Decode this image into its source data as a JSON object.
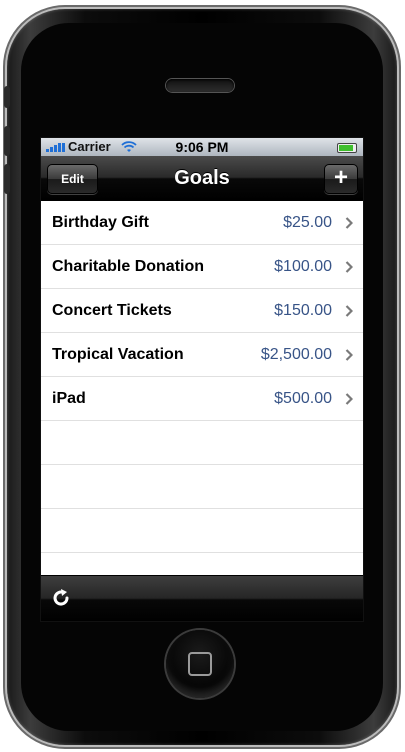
{
  "status_bar": {
    "carrier": "Carrier",
    "time": "9:06 PM"
  },
  "nav_bar": {
    "title": "Goals",
    "edit_label": "Edit",
    "add_label": "+"
  },
  "goals": [
    {
      "name": "Birthday Gift",
      "amount": "$25.00"
    },
    {
      "name": "Charitable Donation",
      "amount": "$100.00"
    },
    {
      "name": "Concert Tickets",
      "amount": "$150.00"
    },
    {
      "name": "Tropical Vacation",
      "amount": "$2,500.00"
    },
    {
      "name": "iPad",
      "amount": "$500.00"
    }
  ],
  "toolbar": {
    "refresh_icon": "refresh-icon"
  },
  "colors": {
    "value_text": "#385487",
    "nav_bar": "#1a1a1a",
    "battery": "#3fbf2e",
    "wifi": "#1f6fd6"
  }
}
